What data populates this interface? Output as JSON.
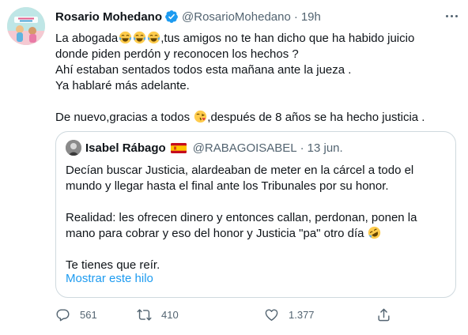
{
  "author": {
    "name": "Rosario Mohedano",
    "handle": "@RosarioMohedano",
    "separator": "·",
    "time": "19h"
  },
  "tweet": {
    "line1_a": "La abogada",
    "line1_b": ",tus amigos no te han dicho que ha habido juicio",
    "line2": "donde piden perdón y reconocen los hechos ?",
    "line3": "Ahí estaban sentados todos esta mañana ante la jueza .",
    "line4": "Ya hablaré más adelante.",
    "line5_a": "De nuevo,gracias a todos",
    "line5_b": ",después de 8 años se ha hecho justicia ."
  },
  "quote": {
    "name": "Isabel Rábago",
    "handle": "@RABAGOISABEL",
    "separator": "·",
    "time": "13 jun.",
    "line1": "Decían buscar Justicia, alardeaban de meter en la cárcel a todo el",
    "line2": "mundo y llegar hasta el final ante los Tribunales por su honor.",
    "line3": "Realidad: les ofrecen dinero y entonces callan, perdonan, ponen la",
    "line4": "mano para cobrar y eso del honor y Justicia \"pa\" otro día",
    "line5": "Te tienes que reír.",
    "show_thread": "Mostrar este hilo"
  },
  "actions": {
    "replies": "561",
    "retweets": "410",
    "likes": "1.377"
  },
  "icons": {
    "verified": "verified-badge-icon",
    "more": "more-icon",
    "laugh": "tears-of-joy-emoji",
    "kiss": "blowing-kiss-emoji",
    "rofl": "rolling-on-floor-laughing-emoji",
    "flag": "spain-flag-icon",
    "reply": "reply-icon",
    "retweet": "retweet-icon",
    "like": "heart-icon",
    "share": "share-icon"
  },
  "colors": {
    "accent": "#1d9bf0",
    "secondary_text": "#536471",
    "border": "#cfd9de"
  }
}
